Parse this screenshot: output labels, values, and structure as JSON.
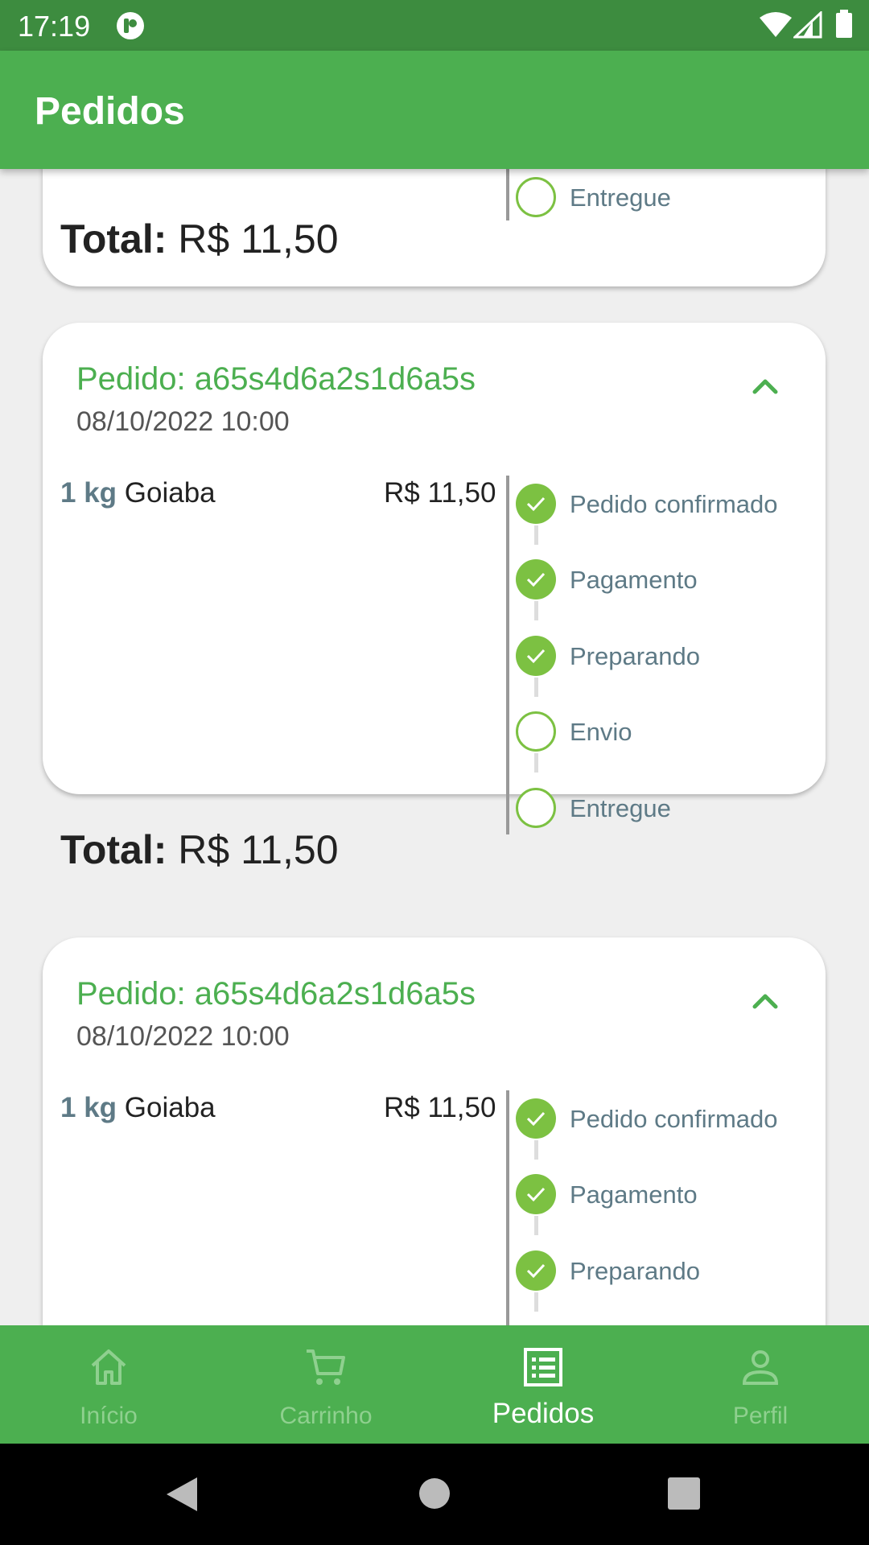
{
  "status_bar": {
    "time": "17:19"
  },
  "app_bar": {
    "title": "Pedidos"
  },
  "partial_card": {
    "last_step_label": "Entregue",
    "total_label": "Total:",
    "total_value": "R$ 11,50"
  },
  "orders": [
    {
      "order_id": "Pedido: a65s4d6a2s1d6a5s",
      "date": "08/10/2022 10:00",
      "item": {
        "qty": "1 kg",
        "name": "Goiaba",
        "price": "R$ 11,50"
      },
      "steps": [
        {
          "label": "Pedido confirmado",
          "done": true
        },
        {
          "label": "Pagamento",
          "done": true
        },
        {
          "label": "Preparando",
          "done": true
        },
        {
          "label": "Envio",
          "done": false
        },
        {
          "label": "Entregue",
          "done": false
        }
      ],
      "total_label": "Total:",
      "total_value": "R$ 11,50"
    },
    {
      "order_id": "Pedido: a65s4d6a2s1d6a5s",
      "date": "08/10/2022 10:00",
      "item": {
        "qty": "1 kg",
        "name": "Goiaba",
        "price": "R$ 11,50"
      },
      "steps": [
        {
          "label": "Pedido confirmado",
          "done": true
        },
        {
          "label": "Pagamento",
          "done": true
        },
        {
          "label": "Preparando",
          "done": true
        }
      ]
    }
  ],
  "bottom_nav": [
    {
      "label": "Início",
      "icon": "home-icon",
      "active": false
    },
    {
      "label": "Carrinho",
      "icon": "cart-icon",
      "active": false
    },
    {
      "label": "Pedidos",
      "icon": "orders-icon",
      "active": true
    },
    {
      "label": "Perfil",
      "icon": "person-icon",
      "active": false
    }
  ],
  "colors": {
    "primary": "#4caf50",
    "status_bar": "#3d8c3f",
    "step_done": "#7cc142",
    "step_text": "#5e7a86"
  }
}
